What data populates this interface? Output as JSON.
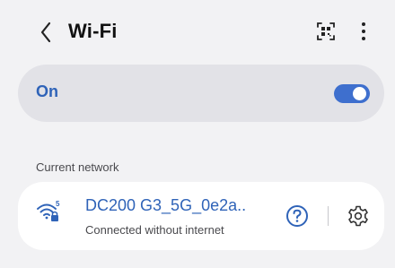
{
  "header": {
    "back_icon": "chevron-left-icon",
    "title": "Wi-Fi",
    "qr_icon": "qr-code-scan-icon",
    "more_icon": "more-vert-icon"
  },
  "wifi_toggle": {
    "label": "On",
    "state": true,
    "accent": "#3e6fce"
  },
  "current_network": {
    "section_label": "Current network",
    "wifi_icon": "wifi-signal-icon",
    "band_badge": "5",
    "name": "DC200 G3_5G_0e2a..",
    "status": "Connected without internet",
    "help_icon": "help-circle-icon",
    "settings_icon": "gear-icon",
    "name_color": "#2f63b8"
  }
}
